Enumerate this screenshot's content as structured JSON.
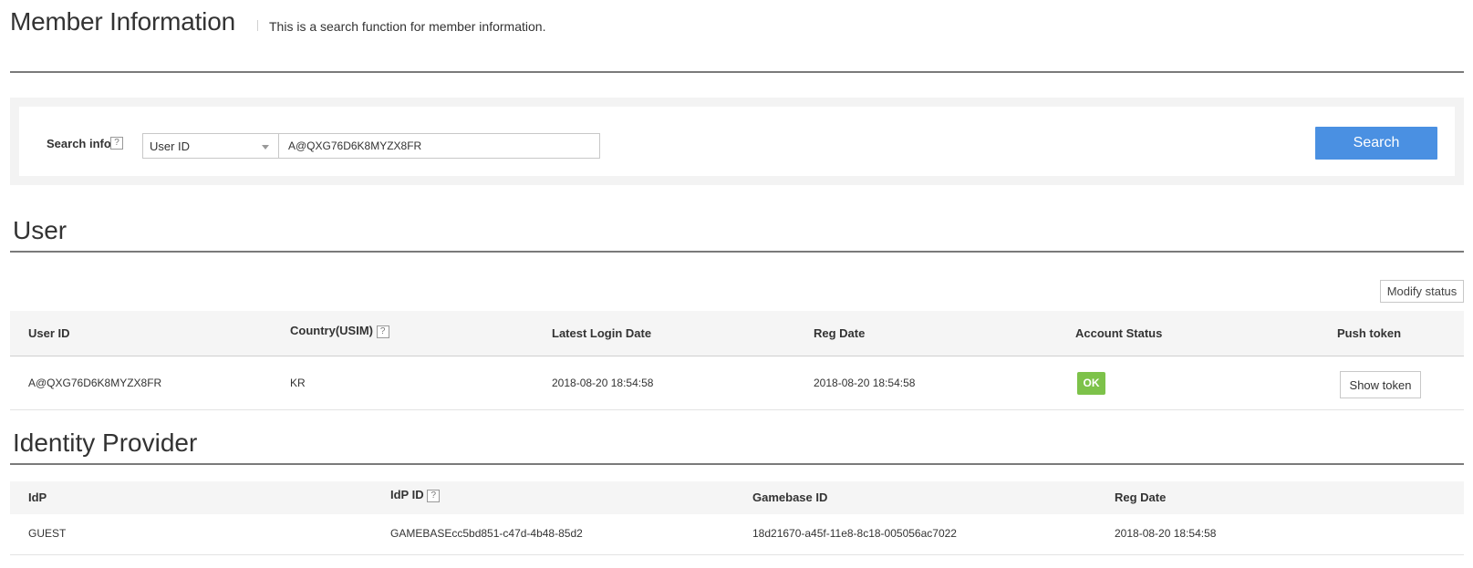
{
  "header": {
    "title": "Member Information",
    "description": "This is a search function for member information."
  },
  "search": {
    "label": "Search info",
    "help": "?",
    "type_selected": "User ID",
    "value": "A@QXG76D6K8MYZX8FR",
    "button_label": "Search"
  },
  "user_section": {
    "title": "User",
    "modify_label": "Modify status",
    "columns": [
      "User ID",
      "Country(USIM)",
      "Latest Login Date",
      "Reg Date",
      "Account Status",
      "Push token"
    ],
    "country_help": "?",
    "row": {
      "user_id": "A@QXG76D6K8MYZX8FR",
      "country": "KR",
      "latest_login": "2018-08-20 18:54:58",
      "reg_date": "2018-08-20 18:54:58",
      "status": "OK",
      "token_label": "Show token"
    }
  },
  "idp_section": {
    "title": "Identity Provider",
    "columns": [
      "IdP",
      "IdP ID",
      "Gamebase ID",
      "Reg Date"
    ],
    "idp_id_help": "?",
    "row": {
      "idp": "GUEST",
      "idp_id": "GAMEBASEcc5bd851-c47d-4b48-85d2",
      "gamebase_id": "18d21670-a45f-11e8-8c18-005056ac7022",
      "reg_date": "2018-08-20 18:54:58"
    }
  },
  "colors": {
    "accent": "#4a90e2",
    "ok": "#7dc24a"
  }
}
